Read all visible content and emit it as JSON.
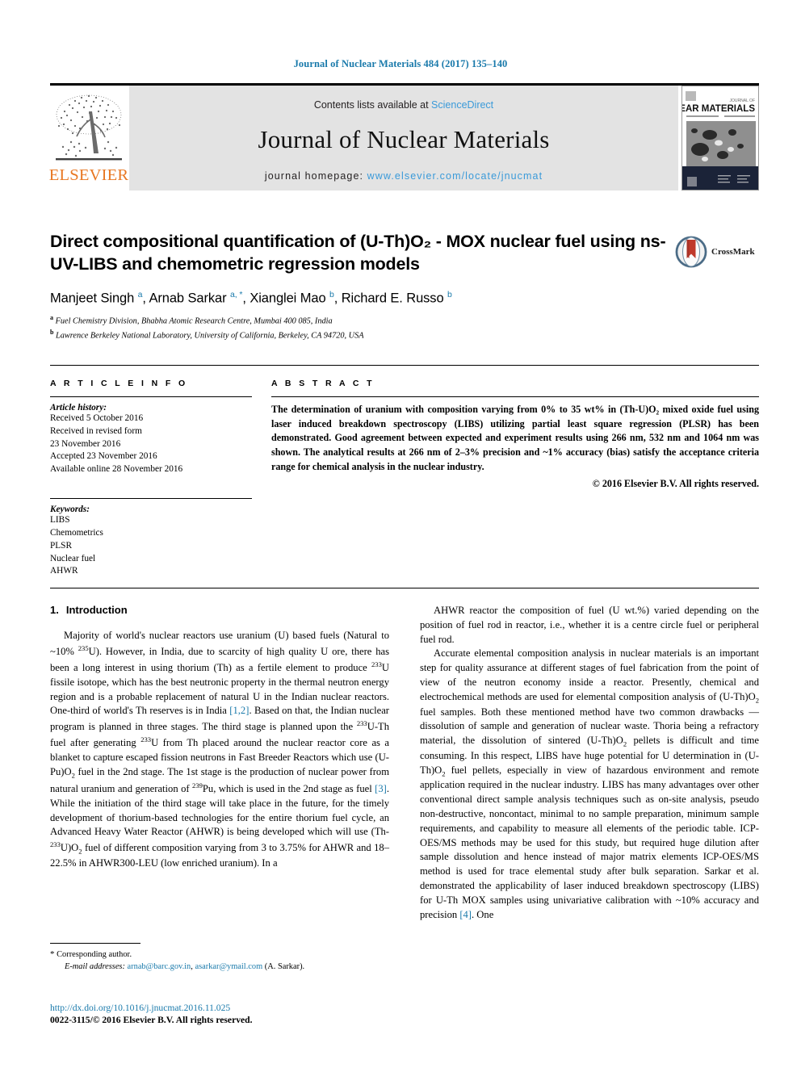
{
  "running_head": "Journal of Nuclear Materials 484 (2017) 135–140",
  "masthead": {
    "publisher": "ELSEVIER",
    "contents_prefix": "Contents lists available at ",
    "contents_link": "ScienceDirect",
    "journal_title": "Journal of Nuclear Materials",
    "homepage_prefix": "journal homepage: ",
    "homepage_url": "www.elsevier.com/locate/jnucmat",
    "cover_journal_line1": "JOURNAL OF",
    "cover_journal_line2": "NUCLEAR MATERIALS"
  },
  "title": "Direct compositional quantification of (U-Th)O₂ - MOX nuclear fuel using ns-UV-LIBS and chemometric regression models",
  "crossmark_label": "CrossMark",
  "authors_html": "Manjeet Singh <sup>a</sup>, Arnab Sarkar <sup>a, *</sup>, Xianglei Mao <sup>b</sup>, Richard E. Russo <sup>b</sup>",
  "affiliations": [
    {
      "marker": "a",
      "text": "Fuel Chemistry Division, Bhabha Atomic Research Centre, Mumbai 400 085, India"
    },
    {
      "marker": "b",
      "text": "Lawrence Berkeley National Laboratory, University of California, Berkeley, CA 94720, USA"
    }
  ],
  "article_info": {
    "heading": "A R T I C L E   I N F O",
    "history_heading": "Article history:",
    "history": [
      "Received 5 October 2016",
      "Received in revised form",
      "23 November 2016",
      "Accepted 23 November 2016",
      "Available online 28 November 2016"
    ],
    "keywords_heading": "Keywords:",
    "keywords": [
      "LIBS",
      "Chemometrics",
      "PLSR",
      "Nuclear fuel",
      "AHWR"
    ]
  },
  "abstract": {
    "heading": "A B S T R A C T",
    "text": "The determination of uranium with composition varying from 0% to 35 wt% in (Th-U)O₂ mixed oxide fuel using laser induced breakdown spectroscopy (LIBS) utilizing partial least square regression (PLSR) has been demonstrated. Good agreement between expected and experiment results using 266 nm, 532 nm and 1064 nm was shown. The analytical results at 266 nm of 2–3% precision and ~1% accuracy (bias) satisfy the acceptance criteria range for chemical analysis in the nuclear industry.",
    "copyright": "© 2016 Elsevier B.V. All rights reserved."
  },
  "introduction": {
    "number": "1.",
    "heading": "Introduction"
  },
  "body": {
    "left_p1_html": "Majority of world's nuclear reactors use uranium (U) based fuels (Natural to ~10% <sup class=\"iso\">235</sup>U). However, in India, due to scarcity of high quality U ore, there has been a long interest in using thorium (Th) as a fertile element to produce <sup class=\"iso\">233</sup>U fissile isotope, which has the best neutronic property in the thermal neutron energy region and is a probable replacement of natural U in the Indian nuclear reactors. One-third of world's Th reserves is in India <span class=\"ref\">[1,2]</span>. Based on that, the Indian nuclear program is planned in three stages. The third stage is planned upon the <sup class=\"iso\">233</sup>U-Th fuel after generating <sup class=\"iso\">233</sup>U from Th placed around the nuclear reactor core as a blanket to capture escaped fission neutrons in Fast Breeder Reactors which use (U-Pu)O<sub class=\"sb\">2</sub> fuel in the 2nd stage. The 1st stage is the production of nuclear power from natural uranium and generation of <sup class=\"iso\">239</sup>Pu, which is used in the 2nd stage as fuel <span class=\"ref\">[3]</span>. While the initiation of the third stage will take place in the future, for the timely development of thorium-based technologies for the entire thorium fuel cycle, an Advanced Heavy Water Reactor (AHWR) is being developed which will use (Th-<sup class=\"iso\">233</sup>U)O<sub class=\"sb\">2</sub> fuel of different composition varying from 3 to 3.75% for AHWR and 18–22.5% in AHWR300-LEU (low enriched uranium). In a",
    "right_p1_html": "AHWR reactor the composition of fuel (U wt.%) varied depending on the position of fuel rod in reactor, i.e., whether it is a centre circle fuel or peripheral fuel rod.",
    "right_p2_html": "Accurate elemental composition analysis in nuclear materials is an important step for quality assurance at different stages of fuel fabrication from the point of view of the neutron economy inside a reactor. Presently, chemical and electrochemical methods are used for elemental composition analysis of (U-Th)O<sub class=\"sb\">2</sub> fuel samples. Both these mentioned method have two common drawbacks — dissolution of sample and generation of nuclear waste. Thoria being a refractory material, the dissolution of sintered (U-Th)O<sub class=\"sb\">2</sub> pellets is difficult and time consuming. In this respect, LIBS have huge potential for U determination in (U-Th)O<sub class=\"sb\">2</sub> fuel pellets, especially in view of hazardous environment and remote application required in the nuclear industry. LIBS has many advantages over other conventional direct sample analysis techniques such as on-site analysis, pseudo non-destructive, noncontact, minimal to no sample preparation, minimum sample requirements, and capability to measure all elements of the periodic table. ICP-OES/MS methods may be used for this study, but required huge dilution after sample dissolution and hence instead of major matrix elements ICP-OES/MS method is used for trace elemental study after bulk separation. Sarkar et al. demonstrated the applicability of laser induced breakdown spectroscopy (LIBS) for U-Th MOX samples using univariative calibration with ~10% accuracy and precision <span class=\"ref\">[4]</span>. One"
  },
  "footnote": {
    "corresponding": "Corresponding author.",
    "email_label": "E-mail addresses:",
    "email1": "arnab@barc.gov.in",
    "email2": "asarkar@ymail.com",
    "email_suffix": "(A. Sarkar)."
  },
  "doi": "http://dx.doi.org/10.1016/j.jnucmat.2016.11.025",
  "issn_line": "0022-3115/© 2016 Elsevier B.V. All rights reserved.",
  "colors": {
    "link_blue": "#1a7aab",
    "sciencedirect_blue": "#3a9ad9",
    "elsevier_orange": "#E87722",
    "banner_grey": "#e3e3e3"
  }
}
